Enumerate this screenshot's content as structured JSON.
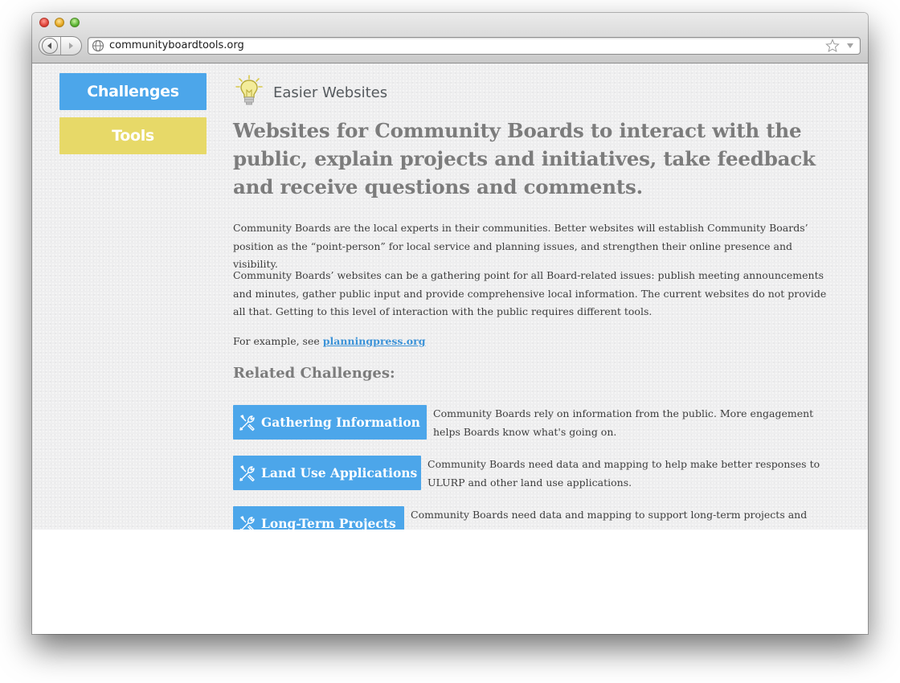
{
  "browser": {
    "url": "communityboardtools.org",
    "icons": [
      "close-icon",
      "minimize-icon",
      "zoom-icon",
      "back-arrow-icon",
      "forward-arrow-icon",
      "globe-icon",
      "star-icon",
      "chevron-down-icon"
    ]
  },
  "sidebar": {
    "challenges_label": "Challenges",
    "tools_label": "Tools",
    "colors": {
      "challenges": "#4ca6ea",
      "tools": "#e7d968"
    }
  },
  "brand": {
    "label": "Easier Websites",
    "icon": "lightbulb-icon"
  },
  "main": {
    "headline": "Websites for Community Boards to interact with the public, explain projects and initiatives, take feedback and receive questions and comments.",
    "paragraph1": "Community Boards are the local experts in their communities. Better websites will establish Community Boards’ position as the “point-person” for local service and planning issues, and strengthen their online presence and visibility.",
    "paragraph2": "Community Boards’ websites can be a gathering point for all Board-related issues: publish meeting announcements and minutes, gather public input and provide comprehensive local information. The current websites do not provide all that. Getting to this level of interaction with the public requires different tools.",
    "example_prefix": "For example, see ",
    "example_link": "planningpress.org",
    "related_heading": "Related Challenges:",
    "challenges": [
      {
        "label": "Gathering Information",
        "description": "Community Boards rely on information from the public. More engagement helps Boards know what's going on."
      },
      {
        "label": "Land Use Applications",
        "description": "Community Boards need data and mapping to help make better responses to ULURP and other land use applications."
      },
      {
        "label": "Long-Term Projects",
        "description": "Community Boards need data and mapping to support long-term projects and initiatives."
      }
    ]
  }
}
